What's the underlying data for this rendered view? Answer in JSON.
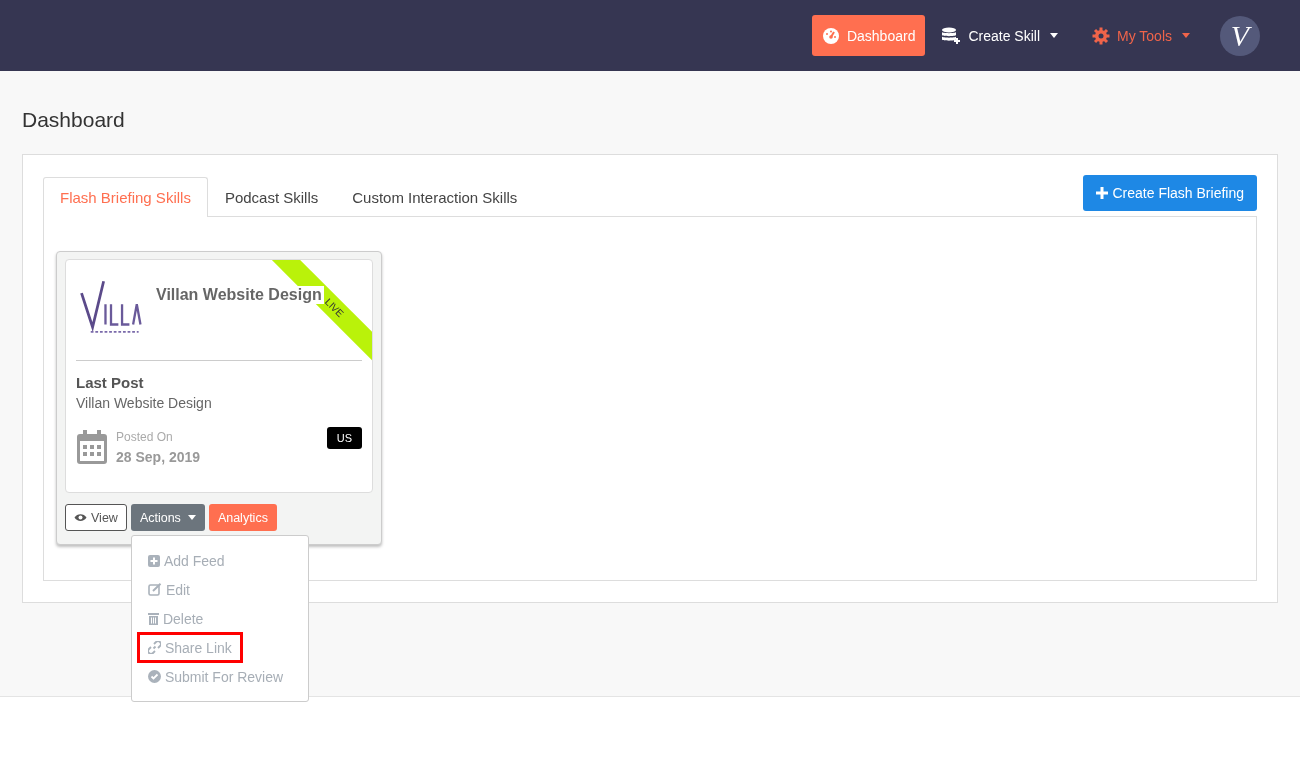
{
  "navbar": {
    "items": [
      {
        "kind": "button",
        "label": "Dashboard",
        "selected": true
      },
      {
        "kind": "dropdown",
        "label": "Create Skill",
        "selected": false
      },
      {
        "kind": "tools",
        "label": "My Tools",
        "selected": false
      }
    ],
    "avatar": "V"
  },
  "page_title": "Dashboard",
  "tabs": [
    {
      "label": "Flash Briefing Skills",
      "selected": true
    },
    {
      "label": "Podcast Skills",
      "selected": false
    },
    {
      "label": "Custom Interaction Skills",
      "selected": false
    }
  ],
  "create_button": "Create Flash Briefing",
  "skill_card": {
    "title": "Villan Website Design",
    "ribbon": "LIVE",
    "last_post_label": "Last Post",
    "last_post": "Villan Website Design",
    "posted_on_label": "Posted On",
    "posted_on": "28 Sep, 2019",
    "locale": "US",
    "buttons": [
      {
        "kind": "view",
        "label": "View"
      },
      {
        "kind": "actions",
        "label": "Actions"
      },
      {
        "kind": "analytics",
        "label": "Analytics"
      }
    ],
    "menu": [
      {
        "kind": "plus",
        "label": "Add Feed",
        "highlighted": false
      },
      {
        "kind": "edit",
        "label": "Edit",
        "highlighted": false
      },
      {
        "kind": "trash",
        "label": "Delete",
        "highlighted": false
      },
      {
        "kind": "link",
        "label": "Share Link",
        "highlighted": true
      },
      {
        "kind": "check",
        "label": "Submit For Review",
        "highlighted": false
      }
    ]
  }
}
